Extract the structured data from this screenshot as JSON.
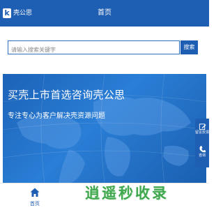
{
  "header": {
    "logo_text": "壳公思",
    "logo_mark": "k",
    "title": "首页"
  },
  "search": {
    "placeholder": "请输入搜索关键字",
    "value": "",
    "button_label": "搜索"
  },
  "banner": {
    "title": "买壳上市首选咨询壳公思",
    "subtitle": "专注专心为客户解决壳资源问题"
  },
  "float_panel": {
    "items": [
      {
        "label": "留言反馈",
        "icon": "edit-icon"
      },
      {
        "label": "咨询",
        "icon": "phone-icon"
      }
    ]
  },
  "footer_nav": [
    {
      "label": "首页",
      "icon": "home-icon",
      "active": true
    },
    {
      "label": "",
      "icon": ""
    },
    {
      "label": "",
      "icon": ""
    }
  ],
  "watermark": "逍遥秒收录",
  "colors": {
    "brand": "#1f5fb3",
    "watermark": "#2b9e3a"
  }
}
